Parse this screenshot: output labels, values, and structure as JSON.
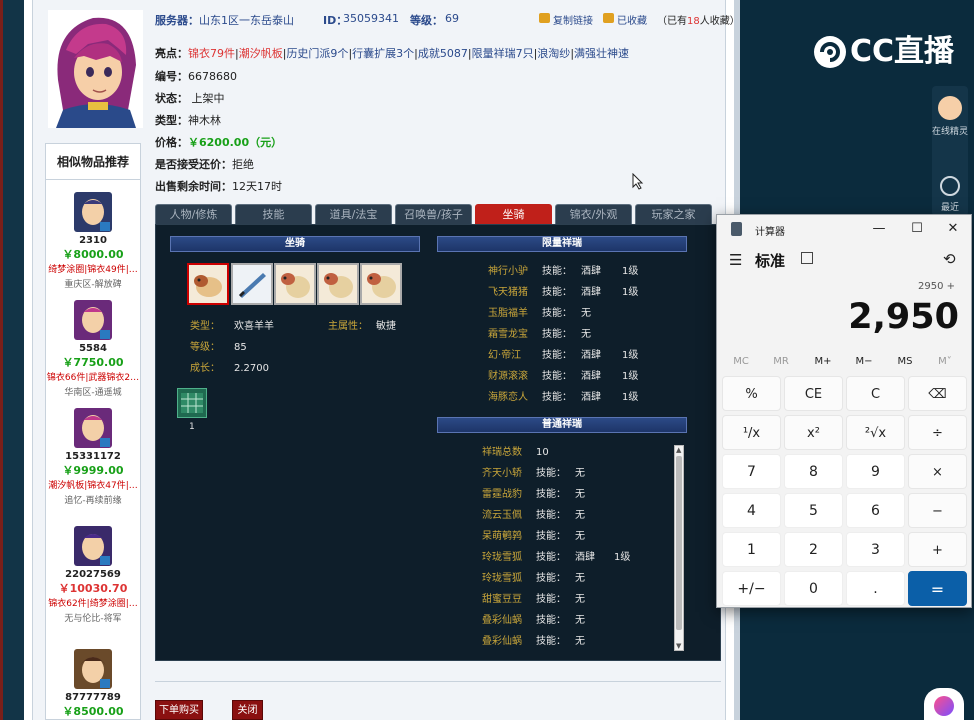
{
  "seller": {
    "server_label": "服务器：",
    "server_value": "山东1区一东岳泰山",
    "id_label": "ID：",
    "id_value": "35059341",
    "level_label": "等级：",
    "level_value": "69",
    "copy_link": "复制链接",
    "favorited": "已收藏",
    "fav_prefix": "（已有",
    "fav_count": "18",
    "fav_suffix": "人收藏）"
  },
  "listing": {
    "highlights_label": "亮点：",
    "highlights": [
      "锦衣79件",
      "潮汐帆板",
      "历史门派9个",
      "行囊扩展3个",
      "成就5087",
      "限量祥瑞7只",
      "浪淘纱",
      "满强壮神速"
    ],
    "number_label": "编号：",
    "number_value": "6678680",
    "status_label": "状态：",
    "status_value": "上架中",
    "type_label": "类型：",
    "type_value": "神木林",
    "price_label": "价格：",
    "price_value": "￥6200.00（元）",
    "bargain_label": "是否接受还价：",
    "bargain_value": "拒绝",
    "remaining_label": "出售剩余时间：",
    "remaining_value": "12天17时"
  },
  "tabs": [
    "人物/修炼",
    "技能",
    "道具/法宝",
    "召唤兽/孩子",
    "坐骑",
    "锦衣/外观",
    "玩家之家"
  ],
  "active_tab": 4,
  "mount_panel": {
    "header": "坐骑",
    "type_label": "类型：",
    "type_value": "欢喜羊羊",
    "attr_label": "主属性：",
    "attr_value": "敏捷",
    "level_label": "等级：",
    "level_value": "85",
    "growth_label": "成长：",
    "growth_value": "2.2700",
    "inv_count": "1"
  },
  "limited": {
    "header": "限量祥瑞",
    "rows": [
      {
        "name": "神行小驴",
        "skill_label": "技能：",
        "skill": "酒肆",
        "lvl": "1级"
      },
      {
        "name": "飞天猪猪",
        "skill_label": "技能：",
        "skill": "酒肆",
        "lvl": "1级"
      },
      {
        "name": "玉脂福羊",
        "skill_label": "技能：",
        "skill": "无",
        "lvl": ""
      },
      {
        "name": "霜雪龙宝",
        "skill_label": "技能：",
        "skill": "无",
        "lvl": ""
      },
      {
        "name": "幻·帝江",
        "skill_label": "技能：",
        "skill": "酒肆",
        "lvl": "1级"
      },
      {
        "name": "财源滚滚",
        "skill_label": "技能：",
        "skill": "酒肆",
        "lvl": "1级"
      },
      {
        "name": "海豚恋人",
        "skill_label": "技能：",
        "skill": "酒肆",
        "lvl": "1级"
      }
    ]
  },
  "normal": {
    "header": "普通祥瑞",
    "total_label": "祥瑞总数",
    "total_value": "10",
    "rows": [
      {
        "name": "齐天小轿",
        "skill_label": "技能：",
        "skill": "无",
        "lvl": ""
      },
      {
        "name": "雷霆战豹",
        "skill_label": "技能：",
        "skill": "无",
        "lvl": ""
      },
      {
        "name": "流云玉佩",
        "skill_label": "技能：",
        "skill": "无",
        "lvl": ""
      },
      {
        "name": "呆萌鹌鹑",
        "skill_label": "技能：",
        "skill": "无",
        "lvl": ""
      },
      {
        "name": "玲珑雪狐",
        "skill_label": "技能：",
        "skill": "酒肆",
        "lvl": "1级"
      },
      {
        "name": "玲珑雪狐",
        "skill_label": "技能：",
        "skill": "无",
        "lvl": ""
      },
      {
        "name": "甜蜜豆豆",
        "skill_label": "技能：",
        "skill": "无",
        "lvl": ""
      },
      {
        "name": "叠彩仙蜗",
        "skill_label": "技能：",
        "skill": "无",
        "lvl": ""
      },
      {
        "name": "叠彩仙蜗",
        "skill_label": "技能：",
        "skill": "无",
        "lvl": ""
      }
    ]
  },
  "similar": {
    "title": "相似物品推荐",
    "items": [
      {
        "id": "2310",
        "price": "￥8000.00",
        "tags": "绮梦涂圈|锦衣49件|…",
        "server": "重庆区-解放碑"
      },
      {
        "id": "5584",
        "price": "￥7750.00",
        "tags": "锦衣66件|武器锦衣2…",
        "server": "华南区-通遥城"
      },
      {
        "id": "15331172",
        "price": "￥9999.00",
        "tags": "潮汐帆板|锦衣47件|…",
        "server": "追忆-再续前缘"
      },
      {
        "id": "22027569",
        "price": "￥10030.70",
        "tags": "锦衣62件|绮梦涂圈|…",
        "server": "无与伦比-将军"
      },
      {
        "id": "87777789",
        "price": "￥8500.00",
        "tags": "",
        "server": ""
      }
    ]
  },
  "actions": {
    "buy": "下单购买",
    "close": "关闭"
  },
  "stream": {
    "logo": "CC直播",
    "online_label": "在线精灵",
    "recent_label": "最近"
  },
  "calculator": {
    "title": "计算器",
    "mode": "标准",
    "expression": "2950 +",
    "display": "2,950",
    "memory": [
      "MC",
      "MR",
      "M+",
      "M−",
      "MS",
      "M˅"
    ],
    "keys": [
      "%",
      "CE",
      "C",
      "⌫",
      "¹/x",
      "x²",
      "²√x",
      "÷",
      "7",
      "8",
      "9",
      "×",
      "4",
      "5",
      "6",
      "−",
      "1",
      "2",
      "3",
      "+",
      "+/−",
      "0",
      ".",
      "="
    ]
  }
}
